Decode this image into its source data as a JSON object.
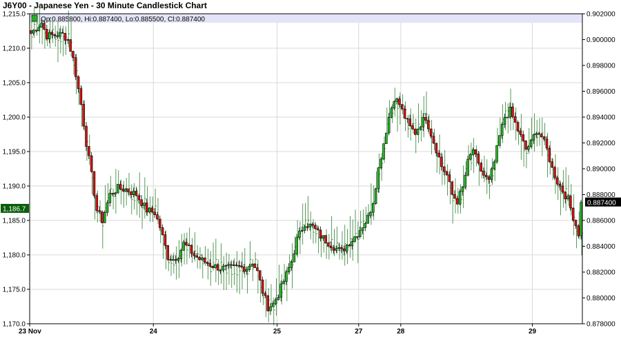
{
  "chart_data": {
    "type": "candlestick",
    "title": "J6Y00 - Japanese Yen - 30 Minute Candlestick Chart",
    "ohlc_label": "Op:0.885800, Hi:0.887400, Lo:0.885500, Cl:0.887400",
    "left_axis": {
      "ylim": [
        1170.0,
        1215.0
      ],
      "ticks": [
        "1,170.0",
        "1,175.0",
        "1,180.0",
        "1,185.0",
        "1,190.0",
        "1,195.0",
        "1,200.0",
        "1,205.0",
        "1,210.0",
        "1,215.0"
      ],
      "tick_values": [
        1170,
        1175,
        1180,
        1185,
        1190,
        1195,
        1200,
        1205,
        1210,
        1215
      ],
      "current_label": "1,186.7",
      "current_value": 1186.7,
      "line_color": "#2e7d2e"
    },
    "right_axis": {
      "ylim": [
        0.878,
        0.902
      ],
      "ticks": [
        "0.878000",
        "0.880000",
        "0.882000",
        "0.884000",
        "0.886000",
        "0.888000",
        "0.890000",
        "0.892000",
        "0.894000",
        "0.896000",
        "0.898000",
        "0.900000",
        "0.902000"
      ],
      "tick_values": [
        0.878,
        0.88,
        0.882,
        0.884,
        0.886,
        0.888,
        0.89,
        0.892,
        0.894,
        0.896,
        0.898,
        0.9,
        0.902
      ],
      "current_label": "0.887400",
      "current_value": 0.8874
    },
    "x_labels": [
      {
        "label": "23 Nov",
        "index": 0
      },
      {
        "label": "24",
        "index": 47
      },
      {
        "label": "25",
        "index": 94
      },
      {
        "label": "27",
        "index": 125
      },
      {
        "label": "28",
        "index": 141
      },
      {
        "label": "29",
        "index": 191
      }
    ],
    "bar_count": 210,
    "grid": true,
    "up_color": "#22bb22",
    "down_color": "#dd1111",
    "anchors_right_axis": [
      [
        0,
        0.9005
      ],
      [
        4,
        0.9013
      ],
      [
        6,
        0.9003
      ],
      [
        12,
        0.9004
      ],
      [
        14,
        0.9
      ],
      [
        16,
        0.8985
      ],
      [
        19,
        0.895
      ],
      [
        21,
        0.892
      ],
      [
        23,
        0.8895
      ],
      [
        25,
        0.8868
      ],
      [
        27,
        0.886
      ],
      [
        30,
        0.888
      ],
      [
        33,
        0.8885
      ],
      [
        36,
        0.8884
      ],
      [
        40,
        0.888
      ],
      [
        44,
        0.8868
      ],
      [
        47,
        0.8866
      ],
      [
        49,
        0.8855
      ],
      [
        52,
        0.8832
      ],
      [
        54,
        0.883
      ],
      [
        56,
        0.8833
      ],
      [
        58,
        0.8842
      ],
      [
        60,
        0.8838
      ],
      [
        62,
        0.8833
      ],
      [
        64,
        0.883
      ],
      [
        67,
        0.8827
      ],
      [
        69,
        0.8825
      ],
      [
        72,
        0.8823
      ],
      [
        76,
        0.8823
      ],
      [
        79,
        0.8824
      ],
      [
        82,
        0.8823
      ],
      [
        84,
        0.8828
      ],
      [
        86,
        0.882
      ],
      [
        88,
        0.8805
      ],
      [
        90,
        0.8793
      ],
      [
        92,
        0.8795
      ],
      [
        94,
        0.8803
      ],
      [
        97,
        0.8818
      ],
      [
        99,
        0.8828
      ],
      [
        101,
        0.8845
      ],
      [
        104,
        0.8858
      ],
      [
        107,
        0.8855
      ],
      [
        110,
        0.8848
      ],
      [
        113,
        0.8843
      ],
      [
        116,
        0.8838
      ],
      [
        118,
        0.8836
      ],
      [
        120,
        0.8841
      ],
      [
        122,
        0.8845
      ],
      [
        124,
        0.885
      ],
      [
        126,
        0.8856
      ],
      [
        128,
        0.8862
      ],
      [
        130,
        0.8875
      ],
      [
        132,
        0.89
      ],
      [
        134,
        0.892
      ],
      [
        136,
        0.894
      ],
      [
        138,
        0.8955
      ],
      [
        140,
        0.895
      ],
      [
        142,
        0.894
      ],
      [
        144,
        0.8932
      ],
      [
        146,
        0.8928
      ],
      [
        148,
        0.8935
      ],
      [
        150,
        0.894
      ],
      [
        152,
        0.8927
      ],
      [
        154,
        0.8915
      ],
      [
        156,
        0.8902
      ],
      [
        158,
        0.8895
      ],
      [
        160,
        0.888
      ],
      [
        162,
        0.8875
      ],
      [
        164,
        0.8885
      ],
      [
        166,
        0.8905
      ],
      [
        168,
        0.8915
      ],
      [
        170,
        0.8902
      ],
      [
        172,
        0.8895
      ],
      [
        174,
        0.889
      ],
      [
        176,
        0.8905
      ],
      [
        178,
        0.8925
      ],
      [
        180,
        0.894
      ],
      [
        182,
        0.8945
      ],
      [
        184,
        0.8935
      ],
      [
        186,
        0.8925
      ],
      [
        188,
        0.8915
      ],
      [
        190,
        0.892
      ],
      [
        192,
        0.893
      ],
      [
        194,
        0.8925
      ],
      [
        196,
        0.8915
      ],
      [
        198,
        0.89
      ],
      [
        200,
        0.889
      ],
      [
        202,
        0.8883
      ],
      [
        204,
        0.8876
      ],
      [
        206,
        0.8863
      ],
      [
        208,
        0.885
      ],
      [
        210,
        0.884
      ],
      [
        212,
        0.8835
      ],
      [
        214,
        0.8855
      ],
      [
        216,
        0.8874
      ]
    ]
  }
}
